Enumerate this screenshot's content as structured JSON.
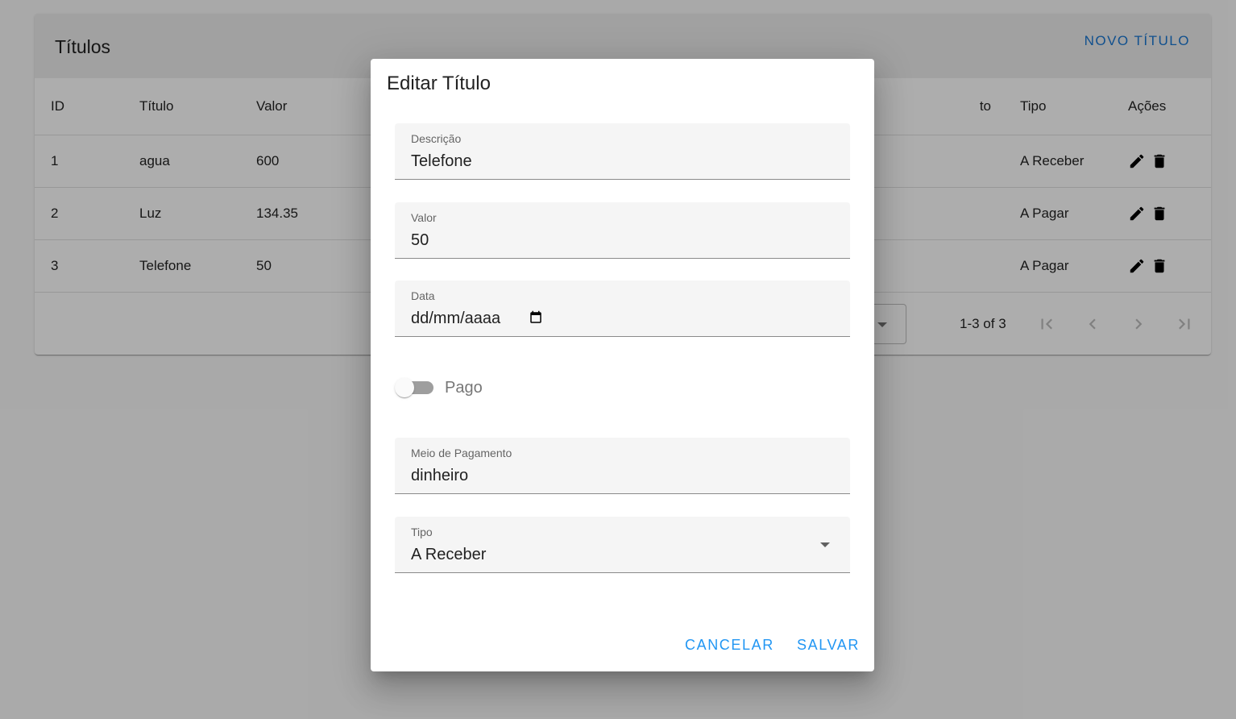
{
  "page": {
    "title": "Títulos",
    "new_button": "NOVO TÍTULO"
  },
  "table": {
    "headers": [
      "ID",
      "Título",
      "Valor",
      "",
      "to",
      "Tipo",
      "Ações"
    ],
    "rows": [
      {
        "id": "1",
        "titulo": "agua",
        "valor": "600",
        "tipo": "A Receber"
      },
      {
        "id": "2",
        "titulo": "Luz",
        "valor": "134.35",
        "tipo": "A Pagar"
      },
      {
        "id": "3",
        "titulo": "Telefone",
        "valor": "50",
        "tipo": "A Pagar"
      }
    ]
  },
  "pagination": {
    "range_text": "1-3 of 3"
  },
  "dialog": {
    "title": "Editar Título",
    "descricao": {
      "label": "Descrição",
      "value": "Telefone"
    },
    "valor": {
      "label": "Valor",
      "value": "50"
    },
    "data": {
      "label": "Data",
      "placeholder": "dd/mm/aaaa"
    },
    "pago": {
      "label": "Pago",
      "checked": false
    },
    "meio_pagamento": {
      "label": "Meio de Pagamento",
      "value": "dinheiro"
    },
    "tipo": {
      "label": "Tipo",
      "value": "A Receber"
    },
    "cancel_label": "CANCELAR",
    "save_label": "SALVAR"
  },
  "colors": {
    "primary": "#1976d2",
    "dialog_button": "#2196f3",
    "toolbar_bg": "#ededed",
    "backdrop": "rgba(0,0,0,0.32)"
  }
}
